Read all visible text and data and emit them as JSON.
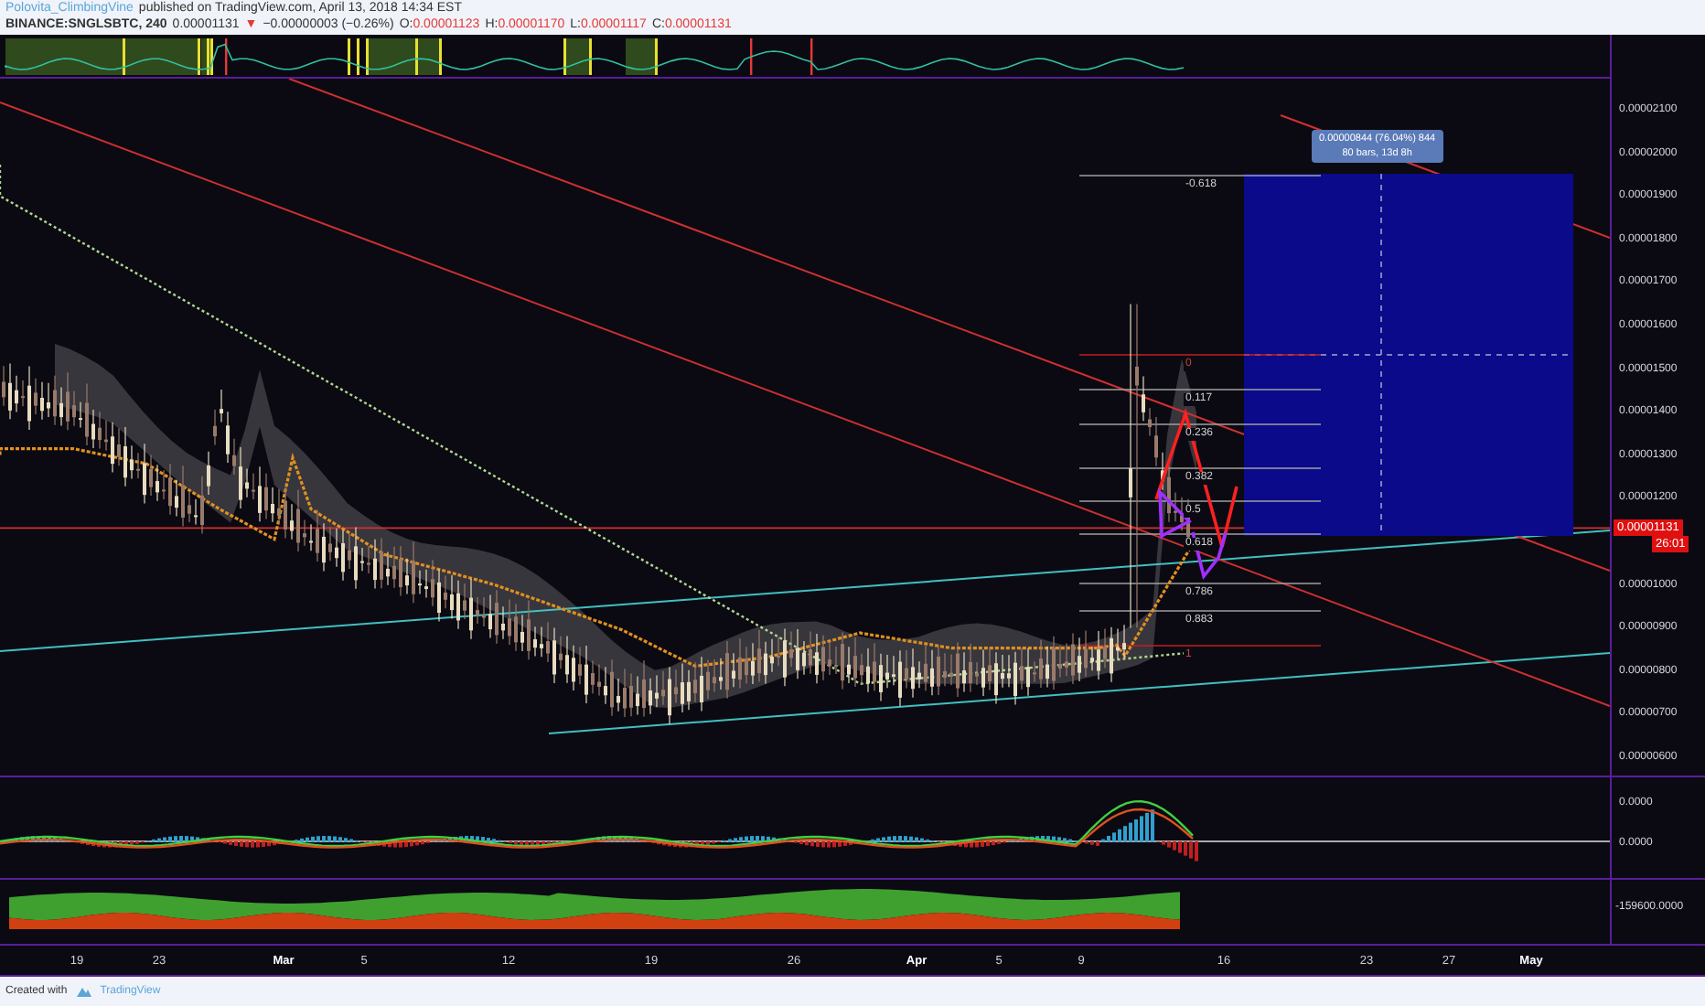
{
  "header": {
    "author": "Polovita_ClimbingVine",
    "published": "published on TradingView.com, April 13, 2018 14:34 EST"
  },
  "legend": {
    "symbol": "BINANCE:SNGLSBTC, 240",
    "price": "0.00001131",
    "arrow": "▼",
    "change": "−0.00000003 (−0.26%)",
    "ohlc": [
      {
        "key": "O:",
        "value": "0.00001123"
      },
      {
        "key": "H:",
        "value": "0.00001170"
      },
      {
        "key": "L:",
        "value": "0.00001117"
      },
      {
        "key": "C:",
        "value": "0.00001131"
      }
    ]
  },
  "price_axis": {
    "labels": [
      "0.00002100",
      "0.00002000",
      "0.00001900",
      "0.00001800",
      "0.00001700",
      "0.00001600",
      "0.00001500",
      "0.00001400",
      "0.00001300",
      "0.00001200",
      "0.00001000",
      "0.00000900",
      "0.00000800",
      "0.00000700",
      "0.00000600"
    ],
    "current_price": "0.00001131",
    "countdown": "26:01"
  },
  "fib_levels": [
    "-0.618",
    "0",
    "0.117",
    "0.236",
    "0.382",
    "0.5",
    "0.618",
    "0.786",
    "0.883",
    "1"
  ],
  "position": {
    "line_1": "0.00000844 (76.04%) 844",
    "line_2": "80 bars, 13d 8h"
  },
  "macd_axis": [
    "0.0000",
    "0.0000"
  ],
  "volume_axis": [
    "-159600.0000"
  ],
  "time_axis": [
    {
      "label": "19",
      "kind": "day"
    },
    {
      "label": "23",
      "kind": "day"
    },
    {
      "label": "Mar",
      "kind": "month"
    },
    {
      "label": "5",
      "kind": "day"
    },
    {
      "label": "12",
      "kind": "day"
    },
    {
      "label": "19",
      "kind": "day"
    },
    {
      "label": "26",
      "kind": "day"
    },
    {
      "label": "Apr",
      "kind": "month"
    },
    {
      "label": "5",
      "kind": "day"
    },
    {
      "label": "9",
      "kind": "day"
    },
    {
      "label": "16",
      "kind": "day"
    },
    {
      "label": "23",
      "kind": "day"
    },
    {
      "label": "27",
      "kind": "day"
    },
    {
      "label": "May",
      "kind": "month"
    }
  ],
  "footer": {
    "created": "Created with",
    "brand": "TradingView"
  }
}
